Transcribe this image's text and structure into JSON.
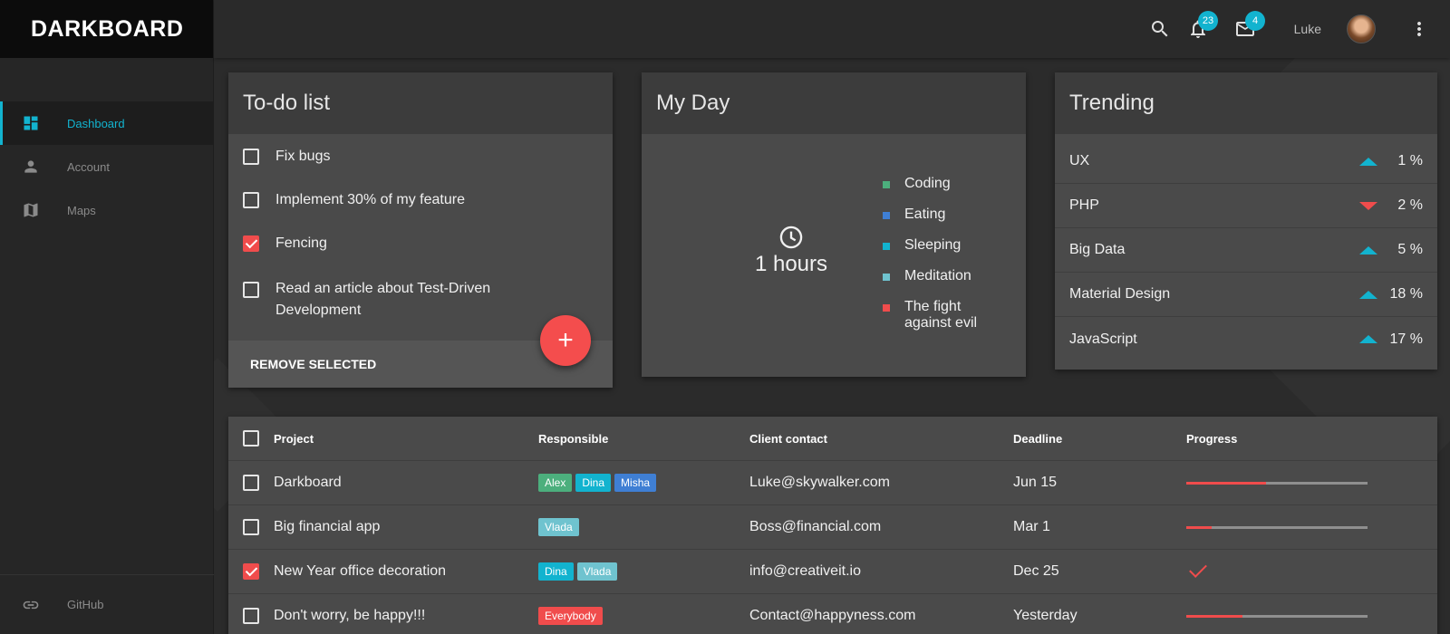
{
  "brand": "DARKBOARD",
  "sidebar": {
    "items": [
      {
        "label": "Dashboard",
        "icon": "dashboard-icon",
        "active": true
      },
      {
        "label": "Account",
        "icon": "person-icon",
        "active": false
      },
      {
        "label": "Maps",
        "icon": "map-icon",
        "active": false
      }
    ],
    "bottom": {
      "label": "GitHub",
      "icon": "link-icon"
    }
  },
  "topbar": {
    "notifications_count": "23",
    "messages_count": "4",
    "username": "Luke"
  },
  "todo": {
    "title": "To-do list",
    "items": [
      {
        "label": "Fix bugs",
        "checked": false
      },
      {
        "label": "Implement 30% of my feature",
        "checked": false
      },
      {
        "label": "Fencing",
        "checked": true
      },
      {
        "label": "Read an article about Test-Driven Development",
        "checked": false
      }
    ],
    "remove_label": "REMOVE SELECTED",
    "fab_label": "+"
  },
  "myday": {
    "title": "My Day",
    "clock_text": "1 hours",
    "legend": [
      {
        "label": "Coding",
        "color": "#4caf7d"
      },
      {
        "label": "Eating",
        "color": "#3f7fd4"
      },
      {
        "label": "Sleeping",
        "color": "#12b3cf"
      },
      {
        "label": "Meditation",
        "color": "#6fc3cf"
      },
      {
        "label": "The fight against evil",
        "color": "#f04c4c"
      }
    ]
  },
  "trending": {
    "title": "Trending",
    "items": [
      {
        "label": "UX",
        "direction": "up",
        "value": "1 %"
      },
      {
        "label": "PHP",
        "direction": "down",
        "value": "2 %"
      },
      {
        "label": "Big Data",
        "direction": "up",
        "value": "5 %"
      },
      {
        "label": "Material Design",
        "direction": "up",
        "value": "18 %"
      },
      {
        "label": "JavaScript",
        "direction": "up",
        "value": "17 %"
      }
    ]
  },
  "projects": {
    "headers": {
      "project": "Project",
      "responsible": "Responsible",
      "contact": "Client contact",
      "deadline": "Deadline",
      "progress": "Progress"
    },
    "rows": [
      {
        "project": "Darkboard",
        "checked": false,
        "responsible": [
          {
            "name": "Alex",
            "color": "#4caf7d"
          },
          {
            "name": "Dina",
            "color": "#12b3cf"
          },
          {
            "name": "Misha",
            "color": "#3f7fd4"
          }
        ],
        "contact": "Luke@skywalker.com",
        "deadline": "Jun 15",
        "progress": 0.44,
        "done": false
      },
      {
        "project": "Big financial app",
        "checked": false,
        "responsible": [
          {
            "name": "Vlada",
            "color": "#6fc3cf"
          }
        ],
        "contact": "Boss@financial.com",
        "deadline": "Mar 1",
        "progress": 0.14,
        "done": false
      },
      {
        "project": "New Year office decoration",
        "checked": true,
        "responsible": [
          {
            "name": "Dina",
            "color": "#12b3cf"
          },
          {
            "name": "Vlada",
            "color": "#6fc3cf"
          }
        ],
        "contact": "info@creativeit.io",
        "deadline": "Dec 25",
        "progress": 1.0,
        "done": true
      },
      {
        "project": "Don't worry, be happy!!!",
        "checked": false,
        "responsible": [
          {
            "name": "Everybody",
            "color": "#f04c4c"
          }
        ],
        "contact": "Contact@happyness.com",
        "deadline": "Yesterday",
        "progress": 0.31,
        "done": false
      }
    ]
  }
}
